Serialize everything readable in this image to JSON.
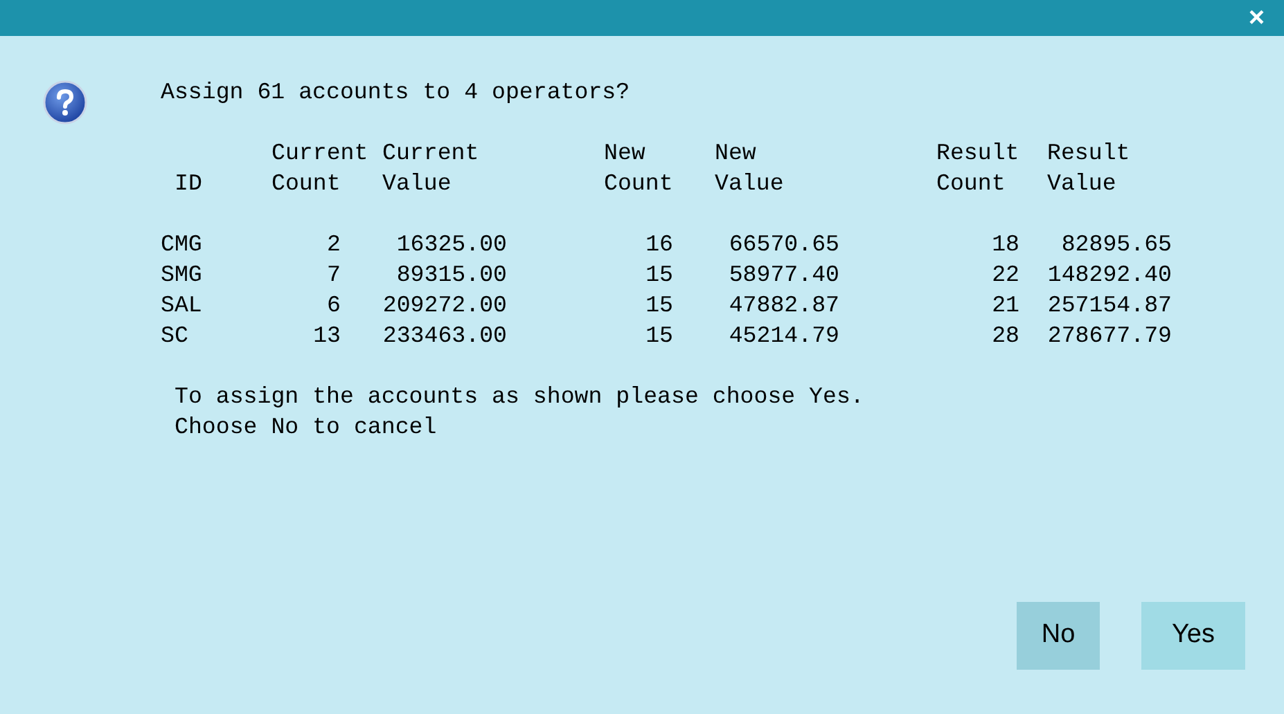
{
  "window": {
    "close": "×"
  },
  "message": {
    "title": "Assign 61 accounts to 4 operators?",
    "columns": [
      "ID",
      "Current Count",
      "Current Value",
      "New Count",
      "New Value",
      "Result Count",
      "Result Value"
    ],
    "rows": [
      [
        "CMG",
        "2",
        "16325.00",
        "16",
        "66570.65",
        "18",
        "82895.65"
      ],
      [
        "SMG",
        "7",
        "89315.00",
        "15",
        "58977.40",
        "22",
        "148292.40"
      ],
      [
        "SAL",
        "6",
        "209272.00",
        "15",
        "47882.87",
        "21",
        "257154.87"
      ],
      [
        "SC",
        "13",
        "233463.00",
        "15",
        "45214.79",
        "28",
        "278677.79"
      ]
    ],
    "footer": [
      "To assign the accounts as shown please choose Yes.",
      "Choose No to cancel"
    ]
  },
  "buttons": [
    {
      "label": "No",
      "focused": true
    },
    {
      "label": "Yes",
      "focused": false
    }
  ]
}
